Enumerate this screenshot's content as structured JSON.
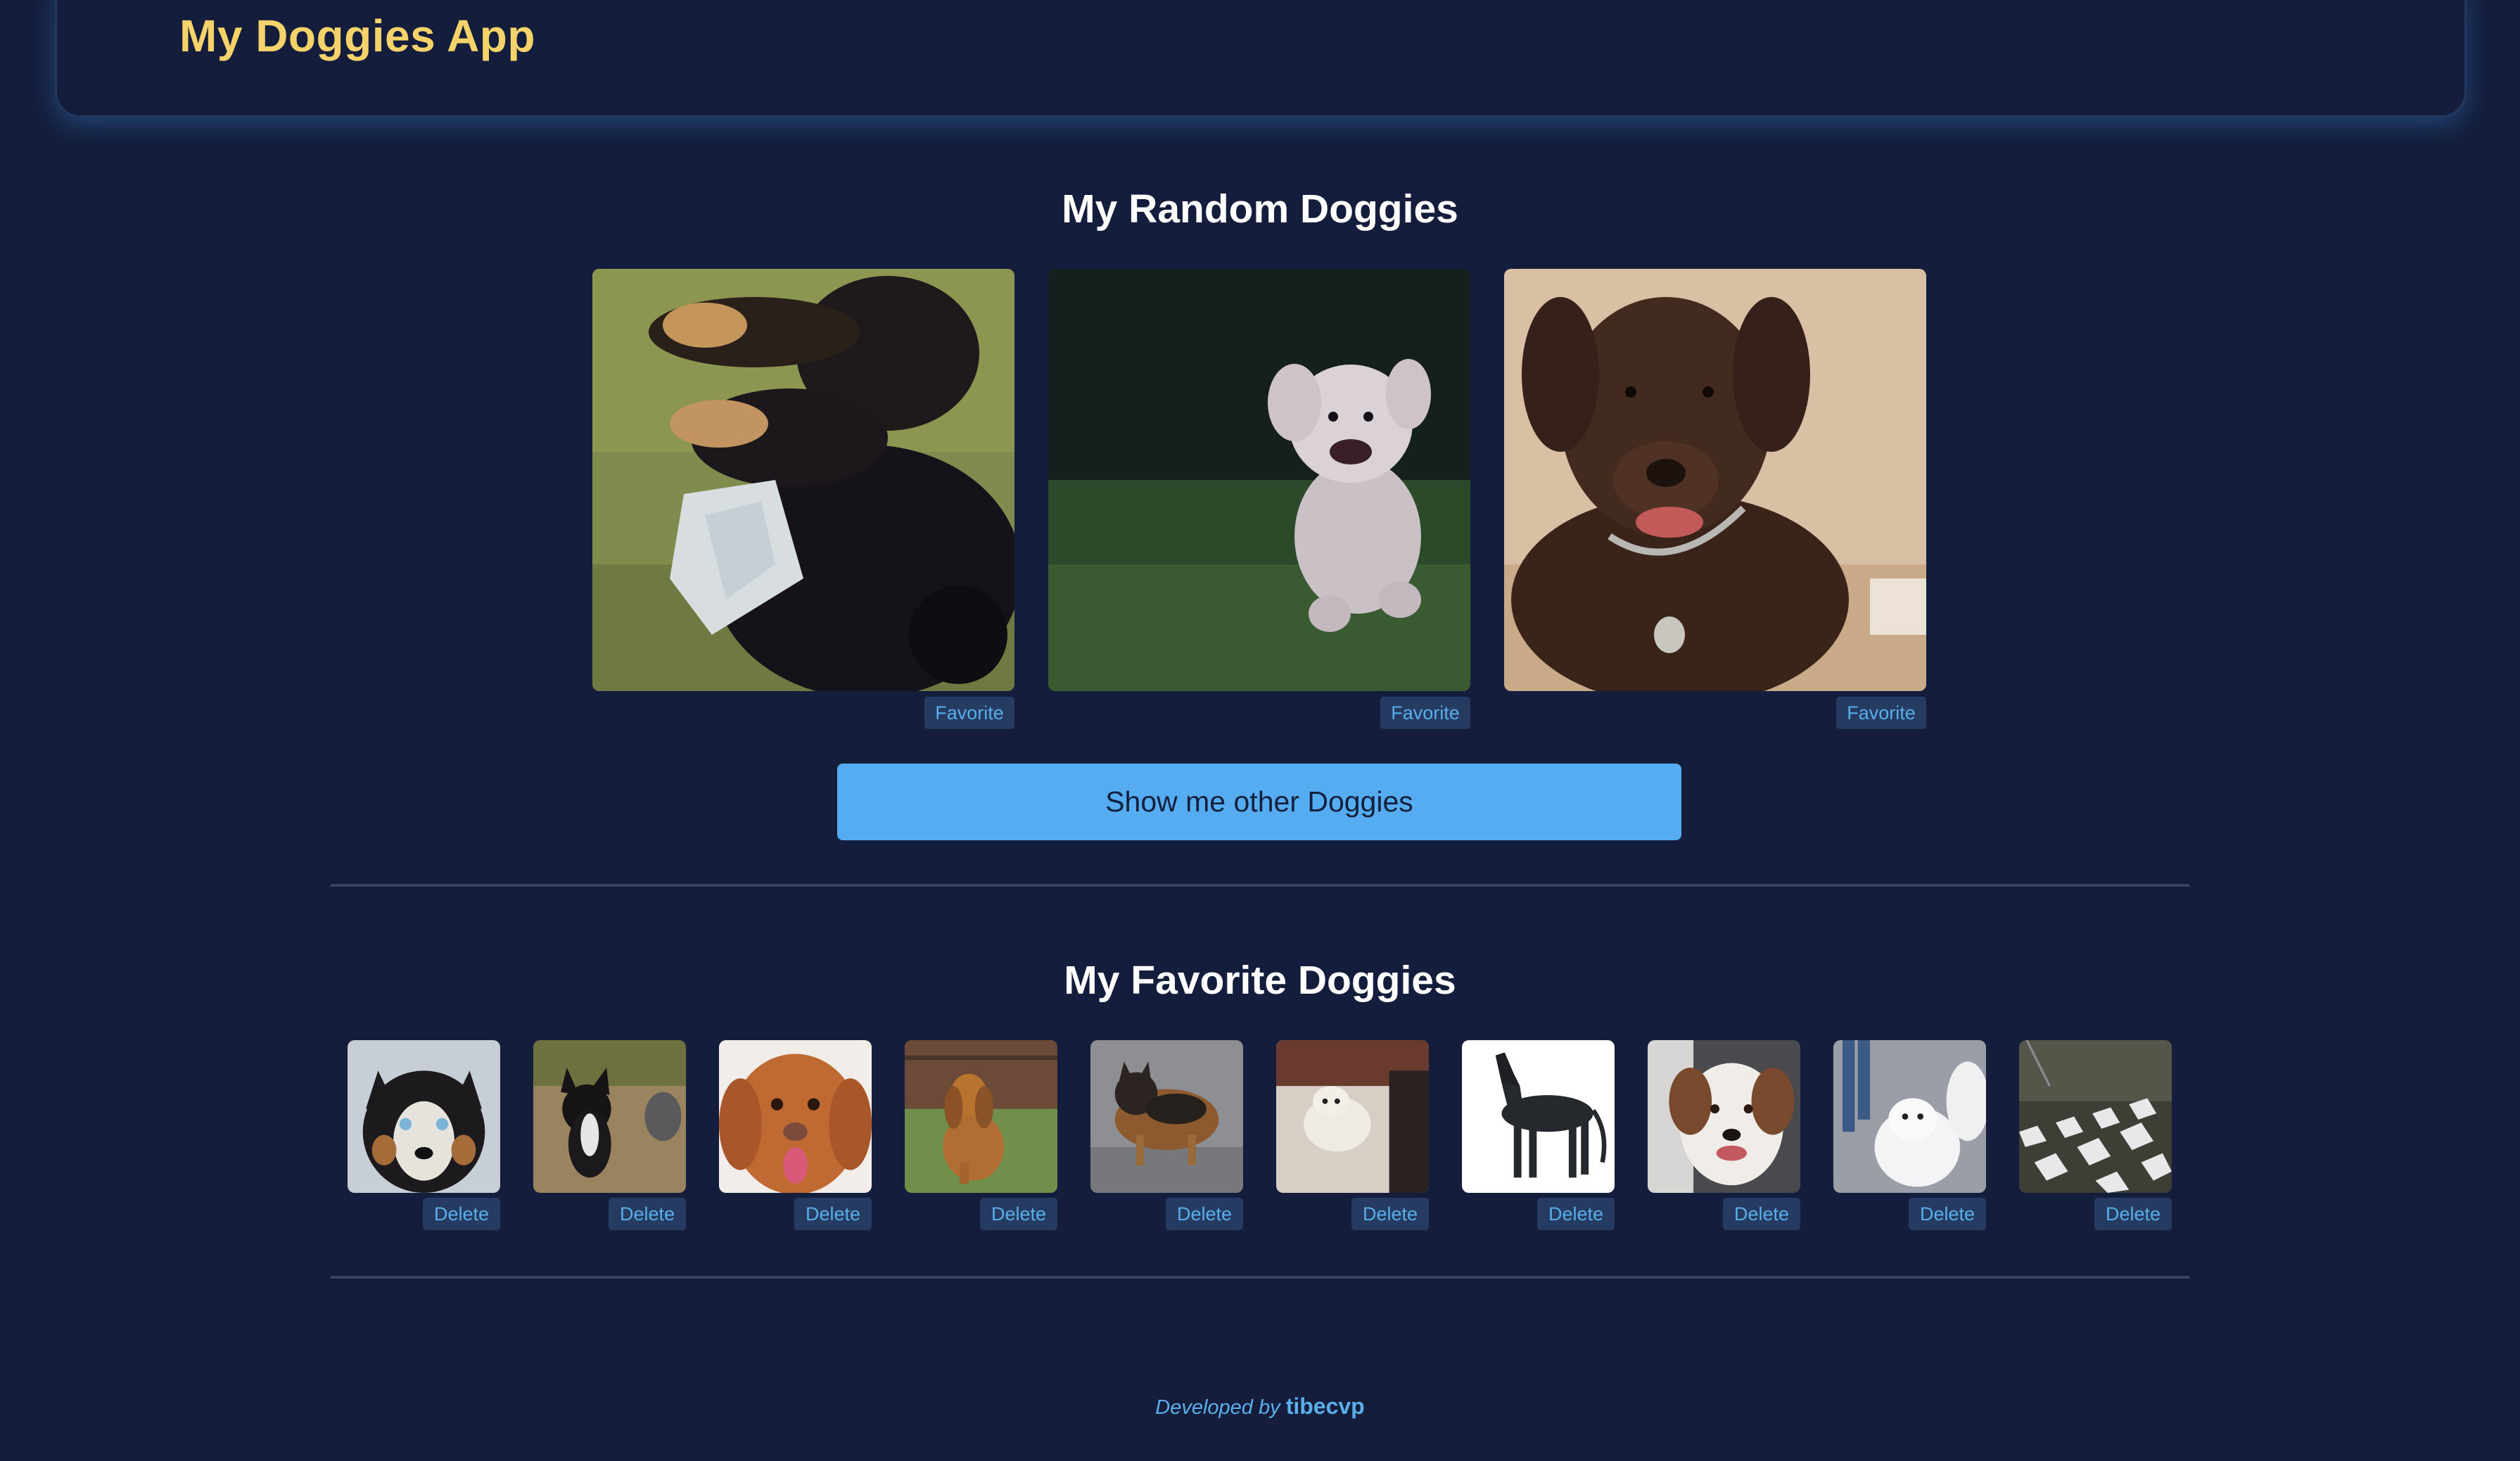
{
  "header": {
    "title": "My Doggies App"
  },
  "random_section": {
    "title": "My Random Doggies",
    "favorite_label": "Favorite",
    "show_button_label": "Show me other Doggies"
  },
  "favorites_section": {
    "title": "My Favorite Doggies",
    "delete_label": "Delete"
  },
  "footer": {
    "developed_by": "Developed by",
    "author": "tibecvp"
  },
  "colors": {
    "background": "#141e3c",
    "title_accent": "#f6d36a",
    "primary_button": "#55acf0",
    "chip_button_bg": "#253b62",
    "chip_button_text": "#59aeea"
  }
}
